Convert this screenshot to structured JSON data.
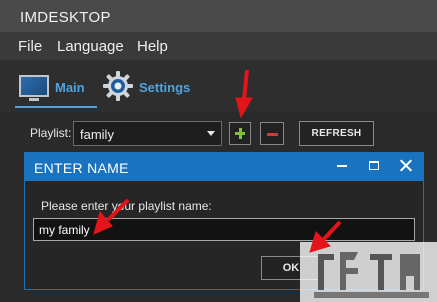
{
  "window": {
    "title": "IMDESKTOP"
  },
  "menu": {
    "items": [
      "File",
      "Language",
      "Help"
    ]
  },
  "tabs": [
    {
      "label": "Main",
      "icon": "monitor-icon",
      "active": true
    },
    {
      "label": "Settings",
      "icon": "gear-icon",
      "active": false
    }
  ],
  "toolbar": {
    "playlist_label": "Playlist:",
    "playlist_value": "family",
    "refresh_label": "REFRESH",
    "add_icon": "plus-icon",
    "remove_icon": "minus-icon"
  },
  "dialog": {
    "title": "ENTER NAME",
    "prompt": "Please enter your playlist name:",
    "input_value": "my family",
    "ok_label": "OK"
  },
  "colors": {
    "accent": "#1a73c0",
    "tab_text": "#4fa3e0",
    "add": "#7ec23a",
    "remove": "#d23a3a",
    "annotation_arrow": "#e4141b"
  }
}
